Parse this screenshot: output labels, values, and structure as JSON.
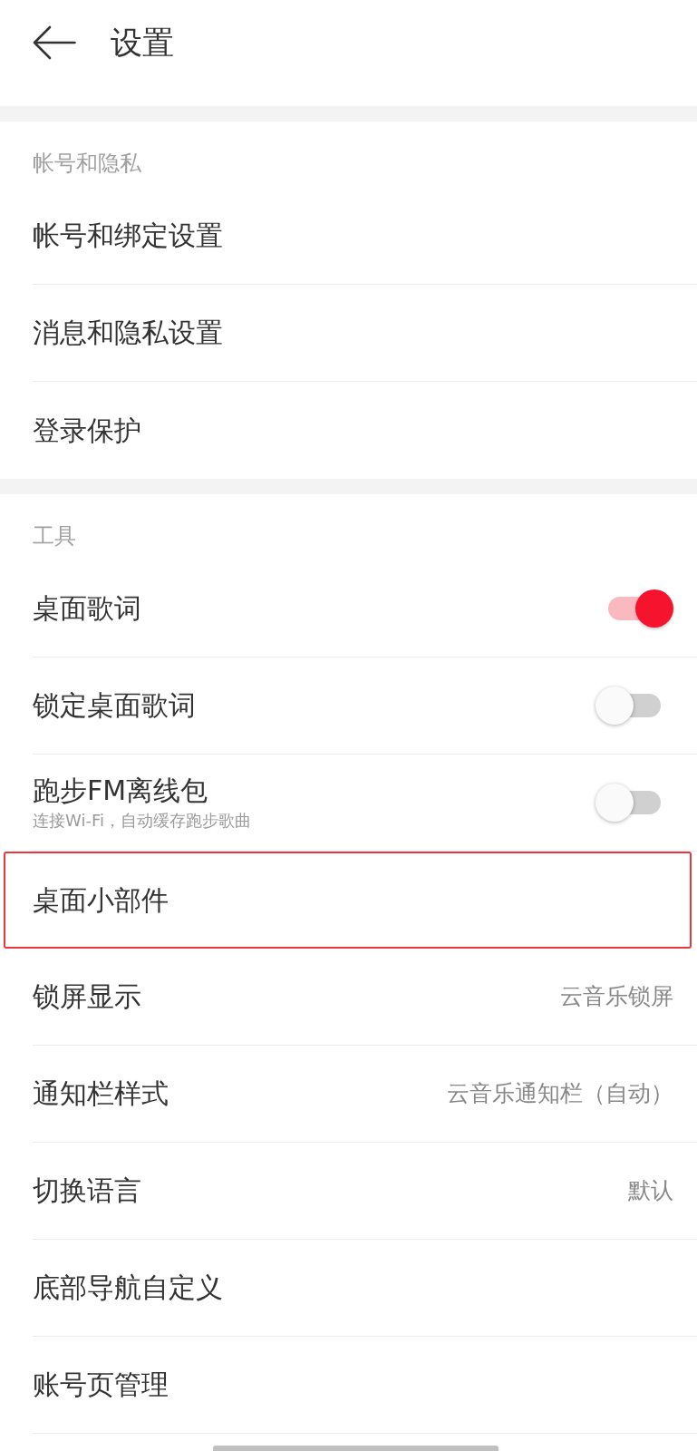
{
  "header": {
    "title": "设置"
  },
  "sections": [
    {
      "title": "帐号和隐私",
      "items": [
        {
          "kind": "link",
          "label": "帐号和绑定设置",
          "highlighted": false
        },
        {
          "kind": "link",
          "label": "消息和隐私设置",
          "highlighted": false
        },
        {
          "kind": "link",
          "label": "登录保护",
          "highlighted": false
        }
      ]
    },
    {
      "title": "工具",
      "items": [
        {
          "kind": "toggle",
          "label": "桌面歌词",
          "on": true,
          "highlighted": false
        },
        {
          "kind": "toggle",
          "label": "锁定桌面歌词",
          "on": false,
          "highlighted": false
        },
        {
          "kind": "toggle",
          "label": "跑步FM离线包",
          "subtitle": "连接Wi-Fi，自动缓存跑步歌曲",
          "on": false,
          "highlighted": false
        },
        {
          "kind": "link",
          "label": "桌面小部件",
          "highlighted": true
        },
        {
          "kind": "link",
          "label": "锁屏显示",
          "value": "云音乐锁屏",
          "highlighted": false
        },
        {
          "kind": "link",
          "label": "通知栏样式",
          "value": "云音乐通知栏（自动）",
          "highlighted": false
        },
        {
          "kind": "link",
          "label": "切换语言",
          "value": "默认",
          "highlighted": false
        },
        {
          "kind": "link",
          "label": "底部导航自定义",
          "highlighted": false
        },
        {
          "kind": "link",
          "label": "账号页管理",
          "highlighted": false
        }
      ]
    }
  ]
}
